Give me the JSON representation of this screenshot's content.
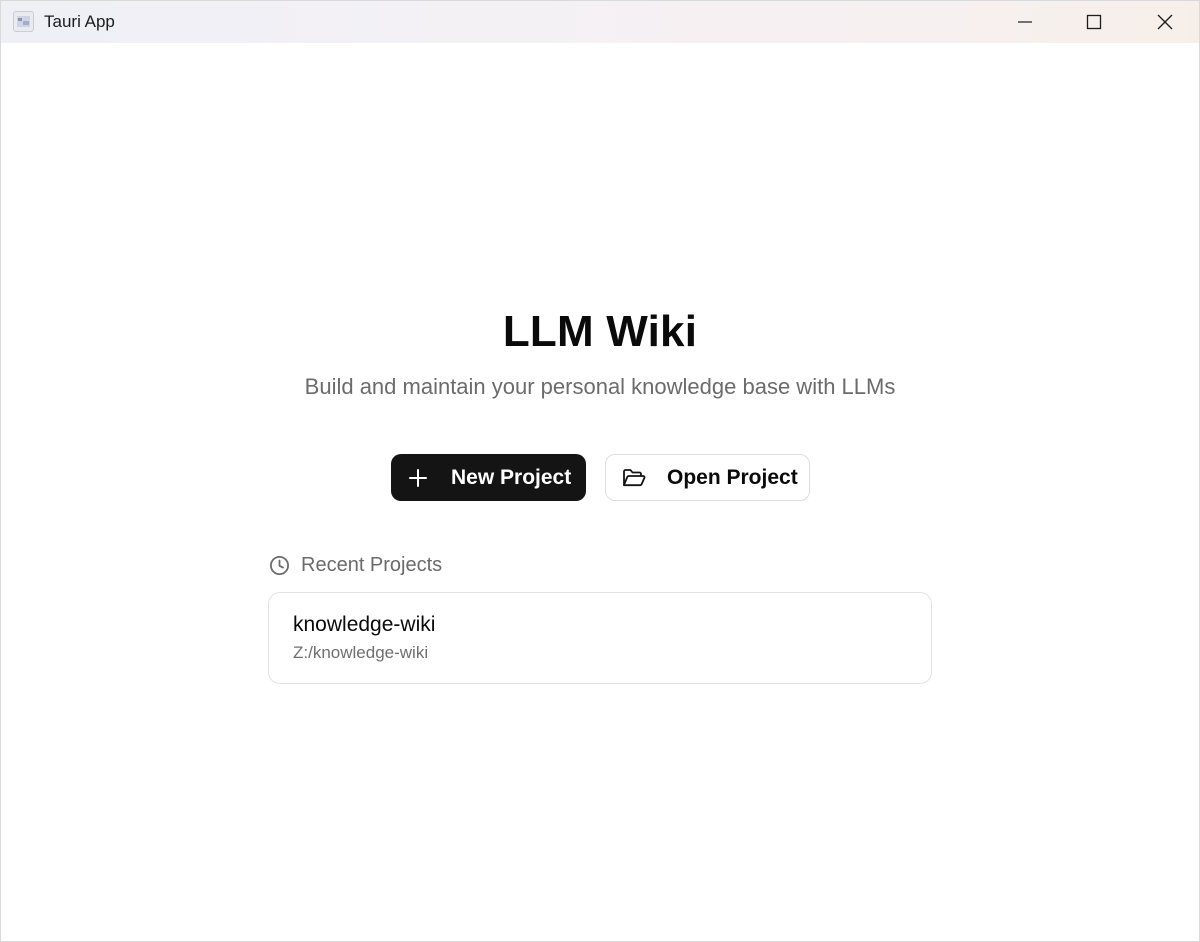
{
  "window": {
    "title": "Tauri App"
  },
  "main": {
    "title": "LLM Wiki",
    "subtitle": "Build and maintain your personal knowledge base with LLMs",
    "actions": {
      "new_project_label": "New Project",
      "open_project_label": "Open Project"
    },
    "recent": {
      "heading": "Recent Projects",
      "projects": [
        {
          "name": "knowledge-wiki",
          "path": "Z:/knowledge-wiki"
        }
      ]
    }
  },
  "icons": {
    "app": "app-icon",
    "minimize": "minimize-icon",
    "maximize": "maximize-icon",
    "close": "close-icon",
    "new_project": "plus-icon",
    "open_project": "folder-open-icon",
    "recent": "clock-icon"
  },
  "colors": {
    "primary_button_bg": "#141414",
    "muted_text": "#6b6b6b",
    "card_border": "#e2e2e2"
  }
}
